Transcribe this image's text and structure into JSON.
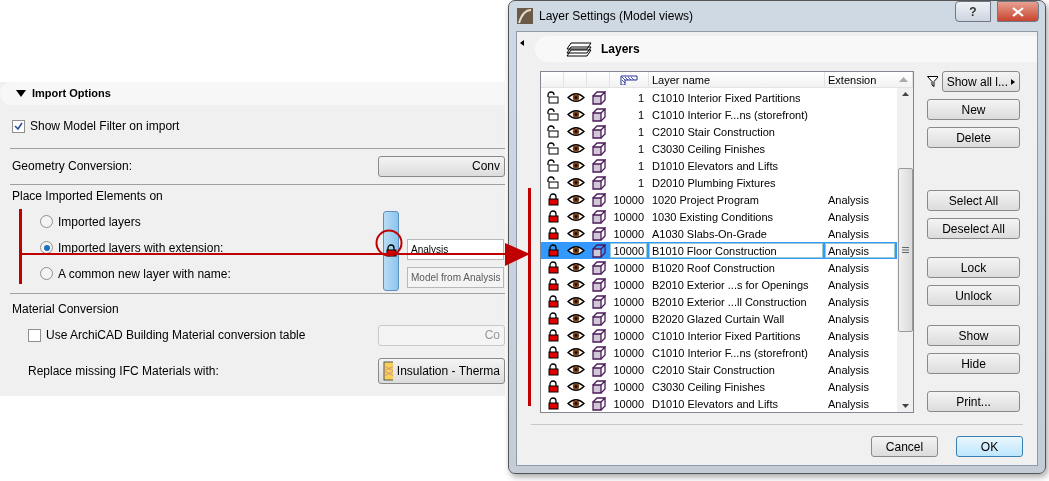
{
  "import_options": {
    "title": "Import Options",
    "show_model_filter": {
      "label": "Show Model Filter on import",
      "checked": true
    },
    "geometry_conversion": {
      "label": "Geometry Conversion:",
      "button": "Conv"
    },
    "place_elements": {
      "title": "Place Imported Elements on",
      "options": [
        {
          "label": "Imported layers",
          "selected": false
        },
        {
          "label": "Imported layers with extension:",
          "selected": true
        },
        {
          "label": "A common new layer with name:",
          "selected": false
        }
      ],
      "link_locked": true,
      "extension_field": {
        "value": "Analysis"
      },
      "name_field": {
        "value": "Model from Analysis",
        "disabled": true
      }
    },
    "material_conversion": {
      "title": "Material Conversion",
      "use_table": {
        "label": "Use ArchiCAD Building Material conversion table",
        "checked": false
      },
      "button": "Co",
      "replace": {
        "label": "Replace missing IFC Materials with:",
        "value": "Insulation - Therma"
      }
    }
  },
  "dialog": {
    "title": "Layer Settings (Model views)",
    "help": "?",
    "panel_title": "Layers",
    "columns": [
      "Layer name",
      "Extension"
    ],
    "rows": [
      {
        "locked": false,
        "number": "1",
        "name": "C1010 Interior Fixed Partitions",
        "selected": false
      },
      {
        "locked": false,
        "number": "1",
        "name": "C1010 Interior F...ns (storefront)",
        "selected": false
      },
      {
        "locked": false,
        "number": "1",
        "name": "C2010 Stair Construction",
        "selected": false
      },
      {
        "locked": false,
        "number": "1",
        "name": "C3030 Ceiling Finishes",
        "selected": false
      },
      {
        "locked": false,
        "number": "1",
        "name": "D1010 Elevators and Lifts",
        "selected": false
      },
      {
        "locked": false,
        "number": "1",
        "name": "D2010 Plumbing Fixtures",
        "selected": false
      },
      {
        "locked": true,
        "number": "10000",
        "name": "1020 Project Program",
        "extension": "Analysis",
        "selected": false
      },
      {
        "locked": true,
        "number": "10000",
        "name": "1030 Existing Conditions",
        "extension": "Analysis",
        "selected": false
      },
      {
        "locked": true,
        "number": "10000",
        "name": "A1030 Slabs-On-Grade",
        "extension": "Analysis",
        "selected": false
      },
      {
        "locked": true,
        "number": "10000",
        "name": "B1010 Floor Construction",
        "extension": "Analysis",
        "selected": true
      },
      {
        "locked": true,
        "number": "10000",
        "name": "B1020 Roof Construction",
        "extension": "Analysis",
        "selected": false
      },
      {
        "locked": true,
        "number": "10000",
        "name": "B2010 Exterior ...s for Openings",
        "extension": "Analysis",
        "selected": false
      },
      {
        "locked": true,
        "number": "10000",
        "name": "B2010 Exterior ...ll Construction",
        "extension": "Analysis",
        "selected": false
      },
      {
        "locked": true,
        "number": "10000",
        "name": "B2020 Glazed Curtain Wall",
        "extension": "Analysis",
        "selected": false
      },
      {
        "locked": true,
        "number": "10000",
        "name": "C1010 Interior Fixed Partitions",
        "extension": "Analysis",
        "selected": false
      },
      {
        "locked": true,
        "number": "10000",
        "name": "C1010 Interior F...ns (storefront)",
        "extension": "Analysis",
        "selected": false
      },
      {
        "locked": true,
        "number": "10000",
        "name": "C2010 Stair Construction",
        "extension": "Analysis",
        "selected": false
      },
      {
        "locked": true,
        "number": "10000",
        "name": "C3030 Ceiling Finishes",
        "extension": "Analysis",
        "selected": false
      },
      {
        "locked": true,
        "number": "10000",
        "name": "D1010 Elevators and Lifts",
        "extension": "Analysis",
        "selected": false
      }
    ],
    "filter_button": "Show all l...",
    "side_buttons": [
      [
        "New",
        "Delete"
      ],
      [
        "Select All",
        "Deselect All"
      ],
      [
        "Lock",
        "Unlock"
      ],
      [
        "Show",
        "Hide"
      ],
      [
        "Print..."
      ]
    ],
    "footer_buttons": [
      {
        "label": "Cancel",
        "default": false
      },
      {
        "label": "OK",
        "default": true
      }
    ]
  }
}
